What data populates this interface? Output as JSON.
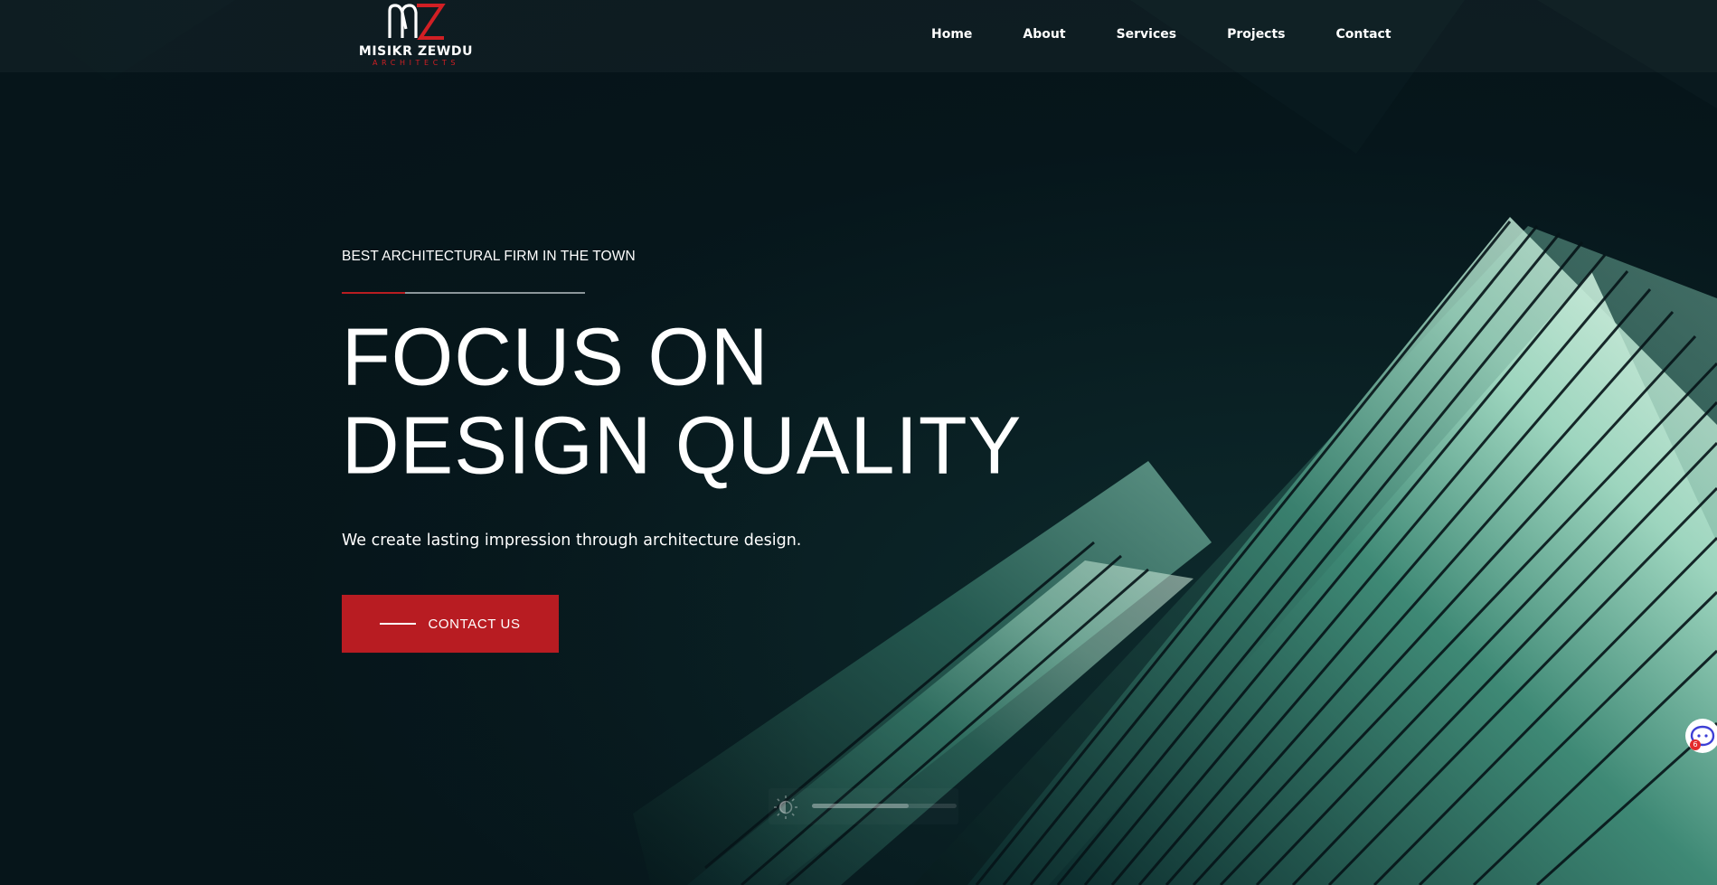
{
  "brand": {
    "name": "MISIKR ZEWDU",
    "subtitle": "ARCHITECTS",
    "logo_icon": "mz-monogram-logo",
    "accent_color": "#b81c22"
  },
  "nav": {
    "items": [
      {
        "label": "Home"
      },
      {
        "label": "About"
      },
      {
        "label": "Services"
      },
      {
        "label": "Projects"
      },
      {
        "label": "Contact"
      }
    ]
  },
  "hero": {
    "eyebrow": "BEST ARCHITECTURAL FIRM IN THE TOWN",
    "headline_line1": "FOCUS ON",
    "headline_line2": "DESIGN QUALITY",
    "tagline": "We create lasting impression through architecture design.",
    "cta_label": "CONTACT US",
    "background": "angular-glass-facade-photo"
  },
  "brightness_control": {
    "icon": "brightness-icon",
    "level": 0.67
  },
  "chat_widget": {
    "icon": "chat-bubble-icon",
    "badge": "6"
  }
}
